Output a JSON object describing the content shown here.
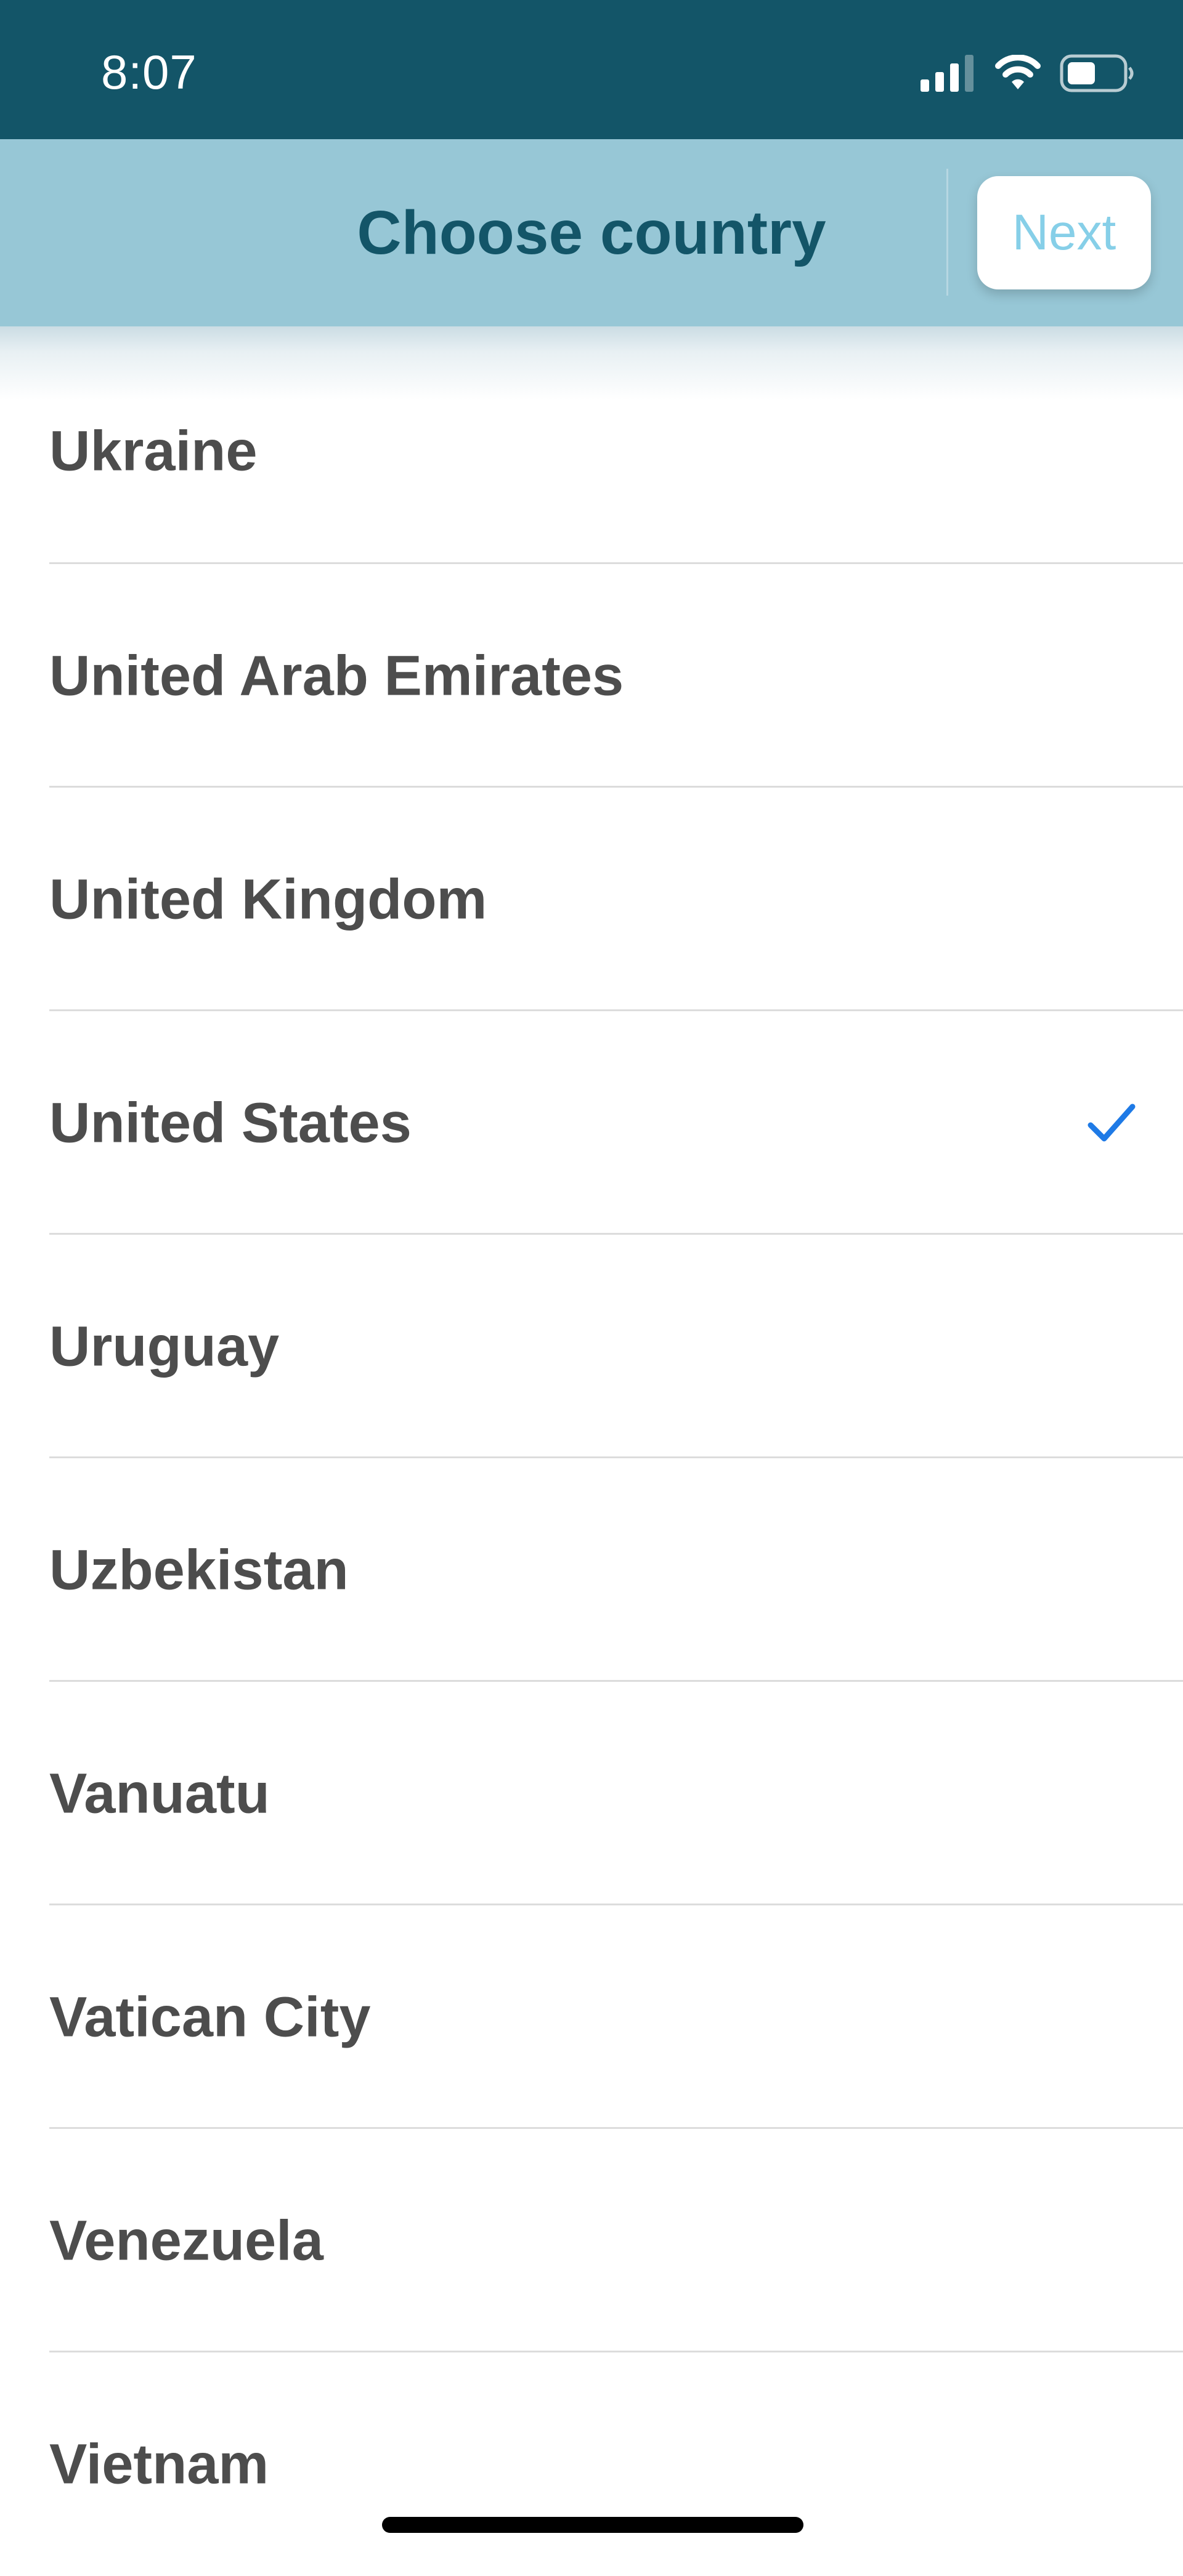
{
  "status_bar": {
    "time": "8:07",
    "background": "#135568",
    "icons": [
      "cellular-signal-icon",
      "wifi-icon",
      "battery-icon"
    ]
  },
  "header": {
    "title": "Choose country",
    "next_label": "Next",
    "background": "#97c7d6",
    "title_color": "#135568",
    "next_color": "#86cfe8"
  },
  "countries": {
    "items": [
      {
        "name": "Ukraine",
        "selected": false
      },
      {
        "name": "United Arab Emirates",
        "selected": false
      },
      {
        "name": "United Kingdom",
        "selected": false
      },
      {
        "name": "United States",
        "selected": true
      },
      {
        "name": "Uruguay",
        "selected": false
      },
      {
        "name": "Uzbekistan",
        "selected": false
      },
      {
        "name": "Vanuatu",
        "selected": false
      },
      {
        "name": "Vatican City",
        "selected": false
      },
      {
        "name": "Venezuela",
        "selected": false
      },
      {
        "name": "Vietnam",
        "selected": false
      }
    ],
    "check_color": "#1e7ae6",
    "selected_icon": "checkmark-icon"
  }
}
